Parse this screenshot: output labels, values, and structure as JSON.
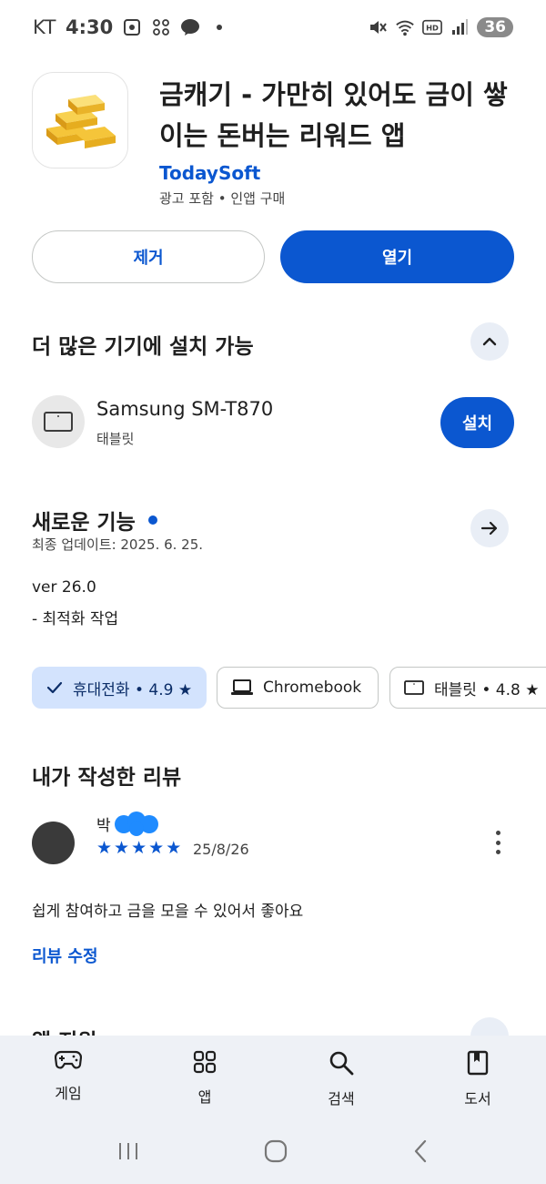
{
  "status_bar": {
    "carrier": "KT",
    "time": "4:30",
    "battery": "36"
  },
  "app": {
    "title": "금캐기 - 가만히 있어도 금이 쌓이는 돈버는 리워드 앱",
    "developer": "TodaySoft",
    "meta": "광고 포함 • 인앱 구매",
    "icon": "gold-bars-icon"
  },
  "actions": {
    "remove_label": "제거",
    "open_label": "열기"
  },
  "more_devices": {
    "title": "더 많은 기기에 설치 가능",
    "device_name": "Samsung SM-T870",
    "device_type": "태블릿",
    "install_label": "설치"
  },
  "whats_new": {
    "title": "새로운 기능",
    "updated": "최종 업데이트: 2025. 6. 25.",
    "version": "ver 26.0",
    "changes": "- 최적화 작업"
  },
  "chips": [
    {
      "label": "휴대전화 • 4.9 ★",
      "selected": true
    },
    {
      "label": "Chromebook",
      "selected": false
    },
    {
      "label": "태블릿 • 4.8 ★",
      "selected": false
    }
  ],
  "my_review": {
    "title": "내가 작성한 리뷰",
    "reviewer": "박",
    "rating": 5,
    "date": "25/8/26",
    "text": "쉽게 참여하고 금을 모을 수 있어서 좋아요",
    "edit_label": "리뷰 수정"
  },
  "next_section": {
    "title": "앱 지원"
  },
  "bottom_nav": [
    {
      "label": "게임",
      "icon": "gamepad-icon"
    },
    {
      "label": "앱",
      "icon": "apps-grid-icon"
    },
    {
      "label": "검색",
      "icon": "search-icon"
    },
    {
      "label": "도서",
      "icon": "book-icon"
    }
  ],
  "colors": {
    "accent": "#0b57d0",
    "chip_selected": "#d3e3fd",
    "nav_bg": "#eef1f6"
  }
}
